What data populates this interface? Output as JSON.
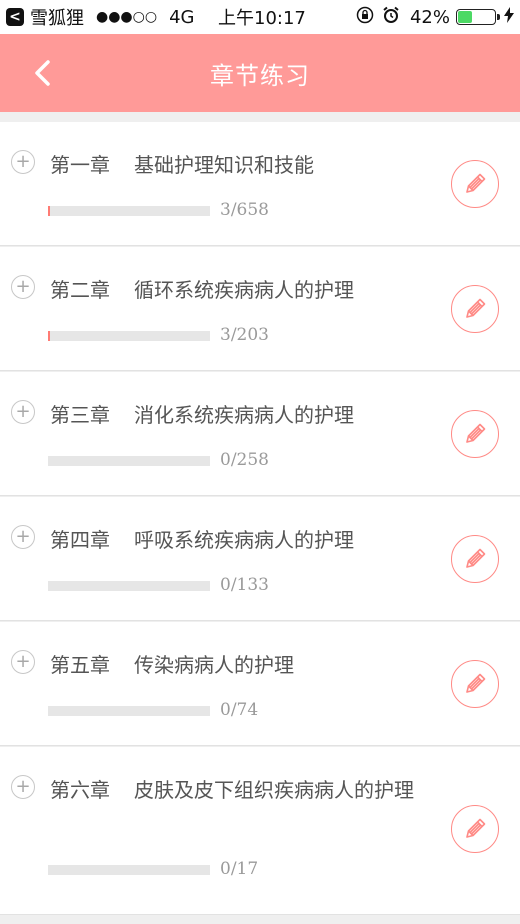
{
  "status_bar": {
    "app_back_label": "雪狐狸",
    "signal": "●●●○○",
    "network": "4G",
    "time": "上午10:17",
    "battery_percent": "42%",
    "battery_level": 0.42,
    "battery_color": "#4cd964"
  },
  "nav": {
    "title": "章节练习",
    "back_icon": "chevron-left-icon",
    "background": "#ff9a98"
  },
  "chapters": [
    {
      "number": "第一章",
      "name": "基础护理知识和技能",
      "progress_text": "3/658",
      "done": 3,
      "total": 658
    },
    {
      "number": "第二章",
      "name": "循环系统疾病病人的护理",
      "progress_text": "3/203",
      "done": 3,
      "total": 203
    },
    {
      "number": "第三章",
      "name": "消化系统疾病病人的护理",
      "progress_text": "0/258",
      "done": 0,
      "total": 258
    },
    {
      "number": "第四章",
      "name": "呼吸系统疾病病人的护理",
      "progress_text": "0/133",
      "done": 0,
      "total": 133
    },
    {
      "number": "第五章",
      "name": "传染病病人的护理",
      "progress_text": "0/74",
      "done": 0,
      "total": 74
    },
    {
      "number": "第六章",
      "name": "皮肤及皮下组织疾病病人的护理",
      "progress_text": "0/17",
      "done": 0,
      "total": 17
    }
  ],
  "icons": {
    "expand": "plus-circle-icon",
    "edit": "pencil-icon"
  },
  "colors": {
    "accent": "#ff9a98",
    "progress_fill": "#ff7b74",
    "progress_track": "#e6e6e6"
  }
}
